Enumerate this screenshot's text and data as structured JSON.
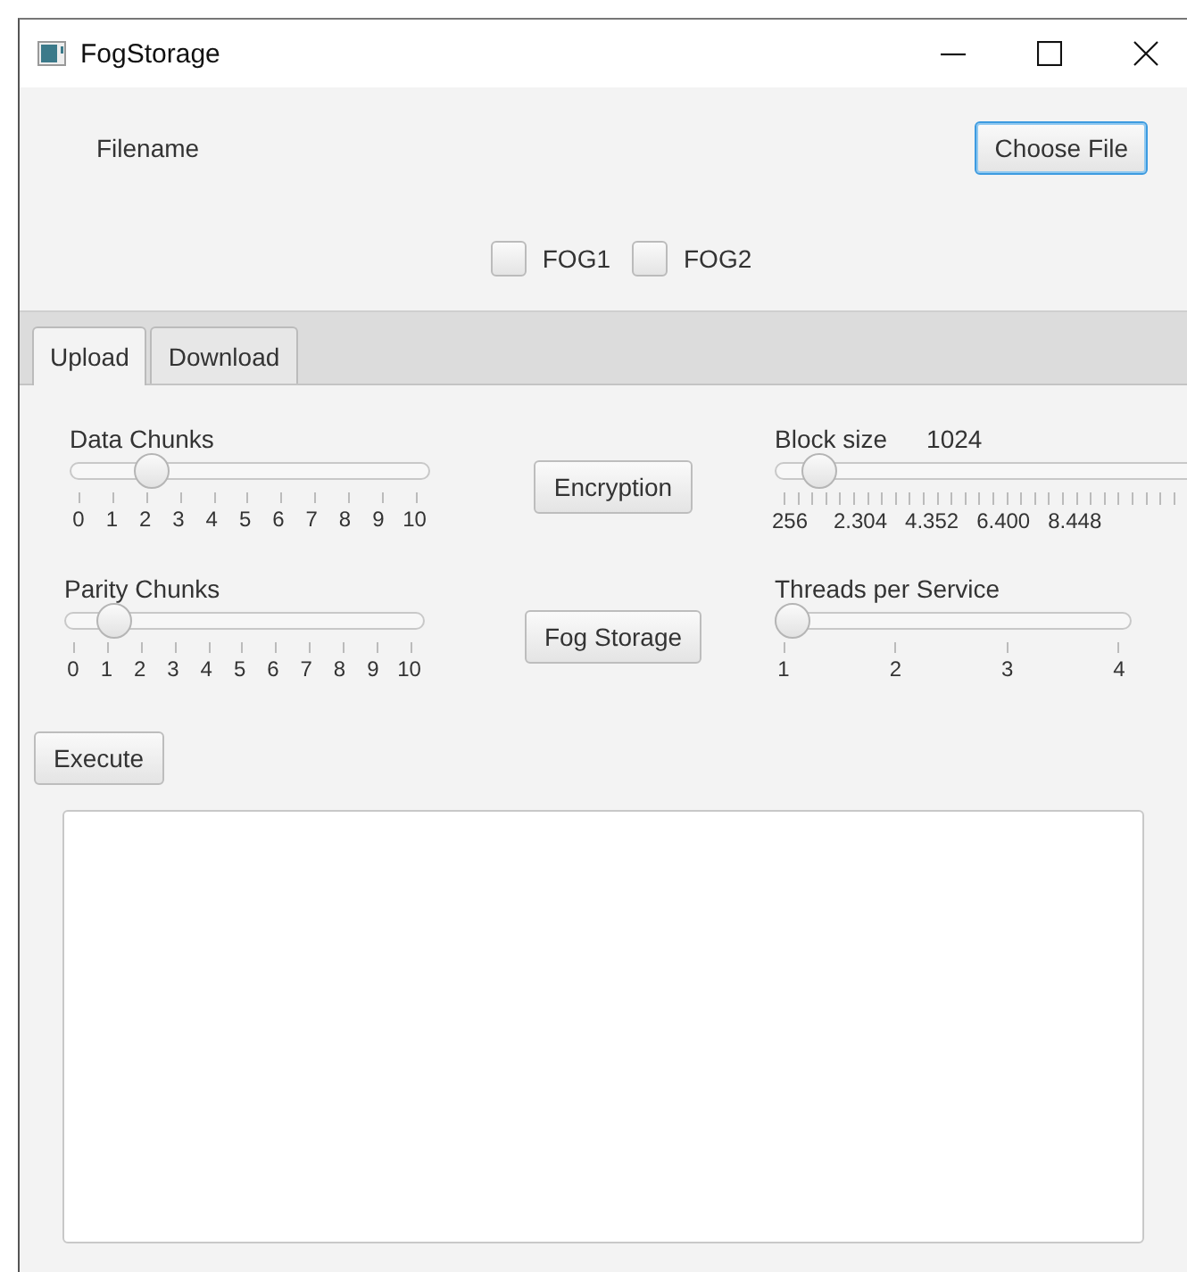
{
  "window": {
    "title": "FogStorage"
  },
  "filename_label": "Filename",
  "choose_file_button": {
    "label": "Choose File",
    "focused": true
  },
  "nodes": [
    {
      "label": "FOG1",
      "checked": false
    },
    {
      "label": "FOG2",
      "checked": false
    }
  ],
  "tabs": [
    {
      "label": "Upload",
      "selected": true
    },
    {
      "label": "Download",
      "selected": false
    }
  ],
  "left_sliders": [
    {
      "name": "Data Chunks",
      "kind": "even",
      "level": 0.2,
      "ticks": [
        "0",
        "1",
        "2",
        "3",
        "4",
        "5",
        "6",
        "7",
        "8",
        "9",
        "10"
      ]
    },
    {
      "name": "Parity Chunks",
      "kind": "even",
      "level": 0.1,
      "ticks": [
        "0",
        "1",
        "2",
        "3",
        "4",
        "5",
        "6",
        "7",
        "8",
        "9",
        "10"
      ]
    }
  ],
  "middle_buttons": [
    "Encryption",
    "Fog Storage"
  ],
  "right_sliders": [
    {
      "name": "Block size",
      "reading": "1024",
      "kind": "clipped",
      "level": 0.04,
      "ticks": [
        "256",
        "2.304",
        "4.352",
        "6.400",
        "8.448"
      ]
    },
    {
      "name": "Threads per Service",
      "kind": "even",
      "level": 0,
      "ticks": [
        "1",
        "2",
        "3",
        "4"
      ]
    }
  ],
  "execute_button": "Execute"
}
